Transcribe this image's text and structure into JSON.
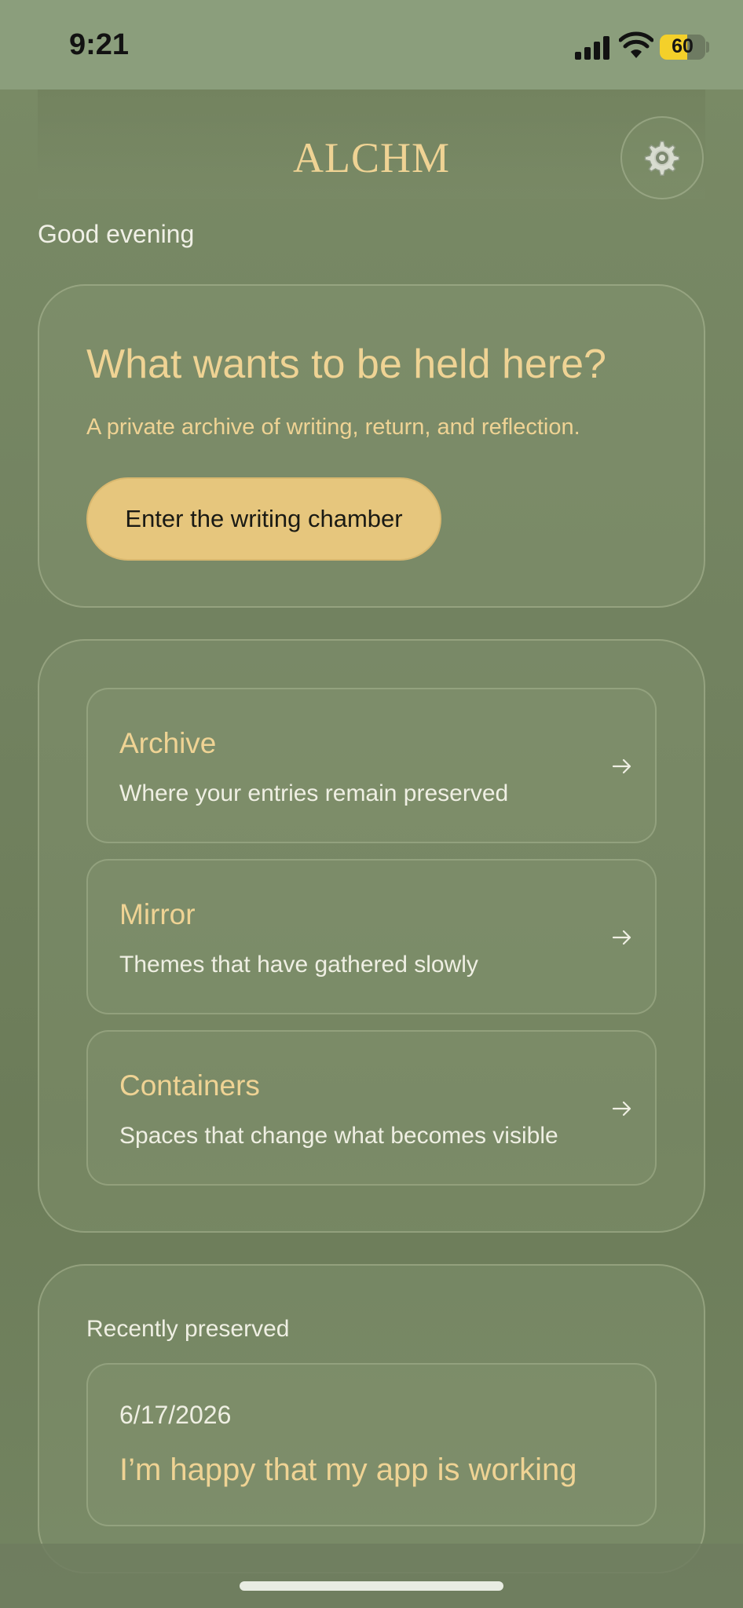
{
  "status_bar": {
    "time": "9:21",
    "battery": "60"
  },
  "header": {
    "title": "ALCHM",
    "settings_icon": "gear-icon"
  },
  "greeting": "Good evening",
  "hero": {
    "title": "What wants to be held here?",
    "subtitle": "A private archive of writing, return, and reflection.",
    "cta_label": "Enter the writing chamber"
  },
  "nav": {
    "items": [
      {
        "title": "Archive",
        "description": "Where your entries remain preserved",
        "icon": "arrow-right-icon"
      },
      {
        "title": "Mirror",
        "description": "Themes that have gathered slowly",
        "icon": "arrow-right-icon"
      },
      {
        "title": "Containers",
        "description": "Spaces that change what becomes visible",
        "icon": "arrow-right-icon"
      }
    ]
  },
  "recent": {
    "heading": "Recently preserved",
    "entries": [
      {
        "date": "6/17/2026",
        "text": "I’m happy that my app is working"
      }
    ]
  },
  "colors": {
    "accent": "#efd394",
    "button": "#e6c67d",
    "background": "#728260"
  }
}
